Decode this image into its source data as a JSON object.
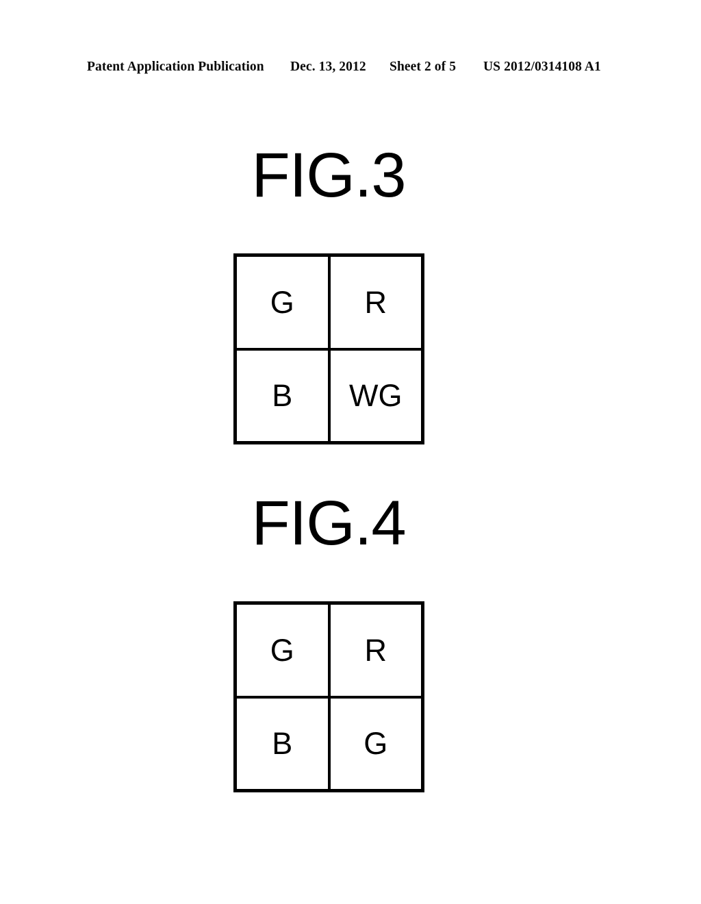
{
  "document": {
    "type": "patent-application-publication-drawing-sheet",
    "header": {
      "publication_label": "Patent Application Publication",
      "publication_date": "Dec. 13, 2012",
      "sheet_label": "Sheet 2 of 5",
      "publication_number": "US 2012/0314108 A1"
    },
    "ink_color": "#000000",
    "paper_color": "#ffffff"
  },
  "figures": [
    {
      "id": "fig-3",
      "title": "FIG.3",
      "grid": {
        "rows": 2,
        "columns": 2,
        "cells": [
          [
            {
              "label": "G"
            },
            {
              "label": "R"
            }
          ],
          [
            {
              "label": "B"
            },
            {
              "label": "WG"
            }
          ]
        ]
      }
    },
    {
      "id": "fig-4",
      "title": "FIG.4",
      "grid": {
        "rows": 2,
        "columns": 2,
        "cells": [
          [
            {
              "label": "G"
            },
            {
              "label": "R"
            }
          ],
          [
            {
              "label": "B"
            },
            {
              "label": "G"
            }
          ]
        ]
      }
    }
  ]
}
